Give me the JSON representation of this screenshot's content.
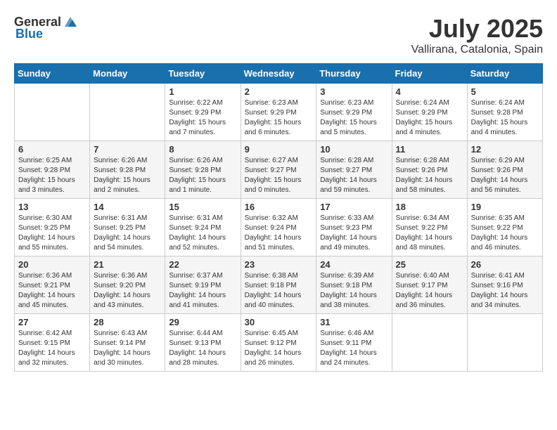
{
  "header": {
    "logo_general": "General",
    "logo_blue": "Blue",
    "month": "July 2025",
    "location": "Vallirana, Catalonia, Spain"
  },
  "weekdays": [
    "Sunday",
    "Monday",
    "Tuesday",
    "Wednesday",
    "Thursday",
    "Friday",
    "Saturday"
  ],
  "weeks": [
    [
      {
        "day": "",
        "sunrise": "",
        "sunset": "",
        "daylight": ""
      },
      {
        "day": "",
        "sunrise": "",
        "sunset": "",
        "daylight": ""
      },
      {
        "day": "1",
        "sunrise": "Sunrise: 6:22 AM",
        "sunset": "Sunset: 9:29 PM",
        "daylight": "Daylight: 15 hours and 7 minutes."
      },
      {
        "day": "2",
        "sunrise": "Sunrise: 6:23 AM",
        "sunset": "Sunset: 9:29 PM",
        "daylight": "Daylight: 15 hours and 6 minutes."
      },
      {
        "day": "3",
        "sunrise": "Sunrise: 6:23 AM",
        "sunset": "Sunset: 9:29 PM",
        "daylight": "Daylight: 15 hours and 5 minutes."
      },
      {
        "day": "4",
        "sunrise": "Sunrise: 6:24 AM",
        "sunset": "Sunset: 9:29 PM",
        "daylight": "Daylight: 15 hours and 4 minutes."
      },
      {
        "day": "5",
        "sunrise": "Sunrise: 6:24 AM",
        "sunset": "Sunset: 9:28 PM",
        "daylight": "Daylight: 15 hours and 4 minutes."
      }
    ],
    [
      {
        "day": "6",
        "sunrise": "Sunrise: 6:25 AM",
        "sunset": "Sunset: 9:28 PM",
        "daylight": "Daylight: 15 hours and 3 minutes."
      },
      {
        "day": "7",
        "sunrise": "Sunrise: 6:26 AM",
        "sunset": "Sunset: 9:28 PM",
        "daylight": "Daylight: 15 hours and 2 minutes."
      },
      {
        "day": "8",
        "sunrise": "Sunrise: 6:26 AM",
        "sunset": "Sunset: 9:28 PM",
        "daylight": "Daylight: 15 hours and 1 minute."
      },
      {
        "day": "9",
        "sunrise": "Sunrise: 6:27 AM",
        "sunset": "Sunset: 9:27 PM",
        "daylight": "Daylight: 15 hours and 0 minutes."
      },
      {
        "day": "10",
        "sunrise": "Sunrise: 6:28 AM",
        "sunset": "Sunset: 9:27 PM",
        "daylight": "Daylight: 14 hours and 59 minutes."
      },
      {
        "day": "11",
        "sunrise": "Sunrise: 6:28 AM",
        "sunset": "Sunset: 9:26 PM",
        "daylight": "Daylight: 14 hours and 58 minutes."
      },
      {
        "day": "12",
        "sunrise": "Sunrise: 6:29 AM",
        "sunset": "Sunset: 9:26 PM",
        "daylight": "Daylight: 14 hours and 56 minutes."
      }
    ],
    [
      {
        "day": "13",
        "sunrise": "Sunrise: 6:30 AM",
        "sunset": "Sunset: 9:25 PM",
        "daylight": "Daylight: 14 hours and 55 minutes."
      },
      {
        "day": "14",
        "sunrise": "Sunrise: 6:31 AM",
        "sunset": "Sunset: 9:25 PM",
        "daylight": "Daylight: 14 hours and 54 minutes."
      },
      {
        "day": "15",
        "sunrise": "Sunrise: 6:31 AM",
        "sunset": "Sunset: 9:24 PM",
        "daylight": "Daylight: 14 hours and 52 minutes."
      },
      {
        "day": "16",
        "sunrise": "Sunrise: 6:32 AM",
        "sunset": "Sunset: 9:24 PM",
        "daylight": "Daylight: 14 hours and 51 minutes."
      },
      {
        "day": "17",
        "sunrise": "Sunrise: 6:33 AM",
        "sunset": "Sunset: 9:23 PM",
        "daylight": "Daylight: 14 hours and 49 minutes."
      },
      {
        "day": "18",
        "sunrise": "Sunrise: 6:34 AM",
        "sunset": "Sunset: 9:22 PM",
        "daylight": "Daylight: 14 hours and 48 minutes."
      },
      {
        "day": "19",
        "sunrise": "Sunrise: 6:35 AM",
        "sunset": "Sunset: 9:22 PM",
        "daylight": "Daylight: 14 hours and 46 minutes."
      }
    ],
    [
      {
        "day": "20",
        "sunrise": "Sunrise: 6:36 AM",
        "sunset": "Sunset: 9:21 PM",
        "daylight": "Daylight: 14 hours and 45 minutes."
      },
      {
        "day": "21",
        "sunrise": "Sunrise: 6:36 AM",
        "sunset": "Sunset: 9:20 PM",
        "daylight": "Daylight: 14 hours and 43 minutes."
      },
      {
        "day": "22",
        "sunrise": "Sunrise: 6:37 AM",
        "sunset": "Sunset: 9:19 PM",
        "daylight": "Daylight: 14 hours and 41 minutes."
      },
      {
        "day": "23",
        "sunrise": "Sunrise: 6:38 AM",
        "sunset": "Sunset: 9:18 PM",
        "daylight": "Daylight: 14 hours and 40 minutes."
      },
      {
        "day": "24",
        "sunrise": "Sunrise: 6:39 AM",
        "sunset": "Sunset: 9:18 PM",
        "daylight": "Daylight: 14 hours and 38 minutes."
      },
      {
        "day": "25",
        "sunrise": "Sunrise: 6:40 AM",
        "sunset": "Sunset: 9:17 PM",
        "daylight": "Daylight: 14 hours and 36 minutes."
      },
      {
        "day": "26",
        "sunrise": "Sunrise: 6:41 AM",
        "sunset": "Sunset: 9:16 PM",
        "daylight": "Daylight: 14 hours and 34 minutes."
      }
    ],
    [
      {
        "day": "27",
        "sunrise": "Sunrise: 6:42 AM",
        "sunset": "Sunset: 9:15 PM",
        "daylight": "Daylight: 14 hours and 32 minutes."
      },
      {
        "day": "28",
        "sunrise": "Sunrise: 6:43 AM",
        "sunset": "Sunset: 9:14 PM",
        "daylight": "Daylight: 14 hours and 30 minutes."
      },
      {
        "day": "29",
        "sunrise": "Sunrise: 6:44 AM",
        "sunset": "Sunset: 9:13 PM",
        "daylight": "Daylight: 14 hours and 28 minutes."
      },
      {
        "day": "30",
        "sunrise": "Sunrise: 6:45 AM",
        "sunset": "Sunset: 9:12 PM",
        "daylight": "Daylight: 14 hours and 26 minutes."
      },
      {
        "day": "31",
        "sunrise": "Sunrise: 6:46 AM",
        "sunset": "Sunset: 9:11 PM",
        "daylight": "Daylight: 14 hours and 24 minutes."
      },
      {
        "day": "",
        "sunrise": "",
        "sunset": "",
        "daylight": ""
      },
      {
        "day": "",
        "sunrise": "",
        "sunset": "",
        "daylight": ""
      }
    ]
  ]
}
